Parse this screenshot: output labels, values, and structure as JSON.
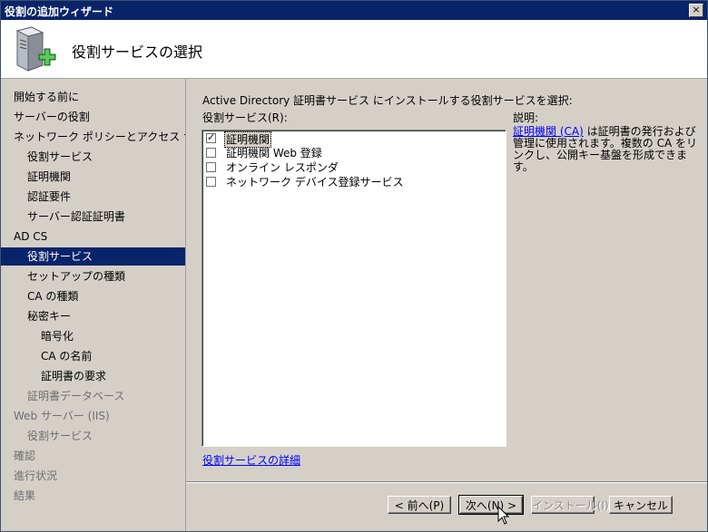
{
  "window": {
    "title": "役割の追加ウィザード",
    "close_glyph": "×"
  },
  "header": {
    "title": "役割サービスの選択",
    "icon": "server-add-icon"
  },
  "sidebar": {
    "items": [
      {
        "label": "開始する前に",
        "level": 0,
        "state": "normal"
      },
      {
        "label": "サーバーの役割",
        "level": 0,
        "state": "normal"
      },
      {
        "label": "ネットワーク ポリシーとアクセス サービ...",
        "level": 0,
        "state": "normal"
      },
      {
        "label": "役割サービス",
        "level": 1,
        "state": "normal"
      },
      {
        "label": "証明機関",
        "level": 1,
        "state": "normal"
      },
      {
        "label": "認証要件",
        "level": 1,
        "state": "normal"
      },
      {
        "label": "サーバー認証証明書",
        "level": 1,
        "state": "normal"
      },
      {
        "label": "AD CS",
        "level": 0,
        "state": "normal"
      },
      {
        "label": "役割サービス",
        "level": 1,
        "state": "selected"
      },
      {
        "label": "セットアップの種類",
        "level": 1,
        "state": "normal"
      },
      {
        "label": "CA の種類",
        "level": 1,
        "state": "normal"
      },
      {
        "label": "秘密キー",
        "level": 1,
        "state": "normal"
      },
      {
        "label": "暗号化",
        "level": 2,
        "state": "normal"
      },
      {
        "label": "CA の名前",
        "level": 2,
        "state": "normal"
      },
      {
        "label": "証明書の要求",
        "level": 2,
        "state": "normal"
      },
      {
        "label": "証明書データベース",
        "level": 1,
        "state": "dim"
      },
      {
        "label": "Web サーバー (IIS)",
        "level": 0,
        "state": "dim"
      },
      {
        "label": "役割サービス",
        "level": 1,
        "state": "dim"
      },
      {
        "label": "確認",
        "level": 0,
        "state": "dim"
      },
      {
        "label": "進行状況",
        "level": 0,
        "state": "dim"
      },
      {
        "label": "結果",
        "level": 0,
        "state": "dim"
      }
    ]
  },
  "main": {
    "instruction": "Active Directory 証明書サービス にインストールする役割サービスを選択:",
    "roles_label": "役割サービス(R):",
    "description_label": "説明:",
    "roles": [
      {
        "label": "証明機関",
        "checked": true
      },
      {
        "label": "証明機関 Web 登録",
        "checked": false
      },
      {
        "label": "オンライン レスポンダ",
        "checked": false
      },
      {
        "label": "ネットワーク デバイス登録サービス",
        "checked": false
      }
    ],
    "description_link": "証明機関 (CA)",
    "description_text": " は証明書の発行および管理に使用されます。複数の CA をリンクし、公開キー基盤を形成できます。",
    "more_link": "役割サービスの詳細",
    "check_glyph": "✓"
  },
  "buttons": {
    "prev": "< 前へ(P)",
    "next": "次へ(N) >",
    "install": "インストール(I)",
    "cancel": "キャンセル"
  }
}
